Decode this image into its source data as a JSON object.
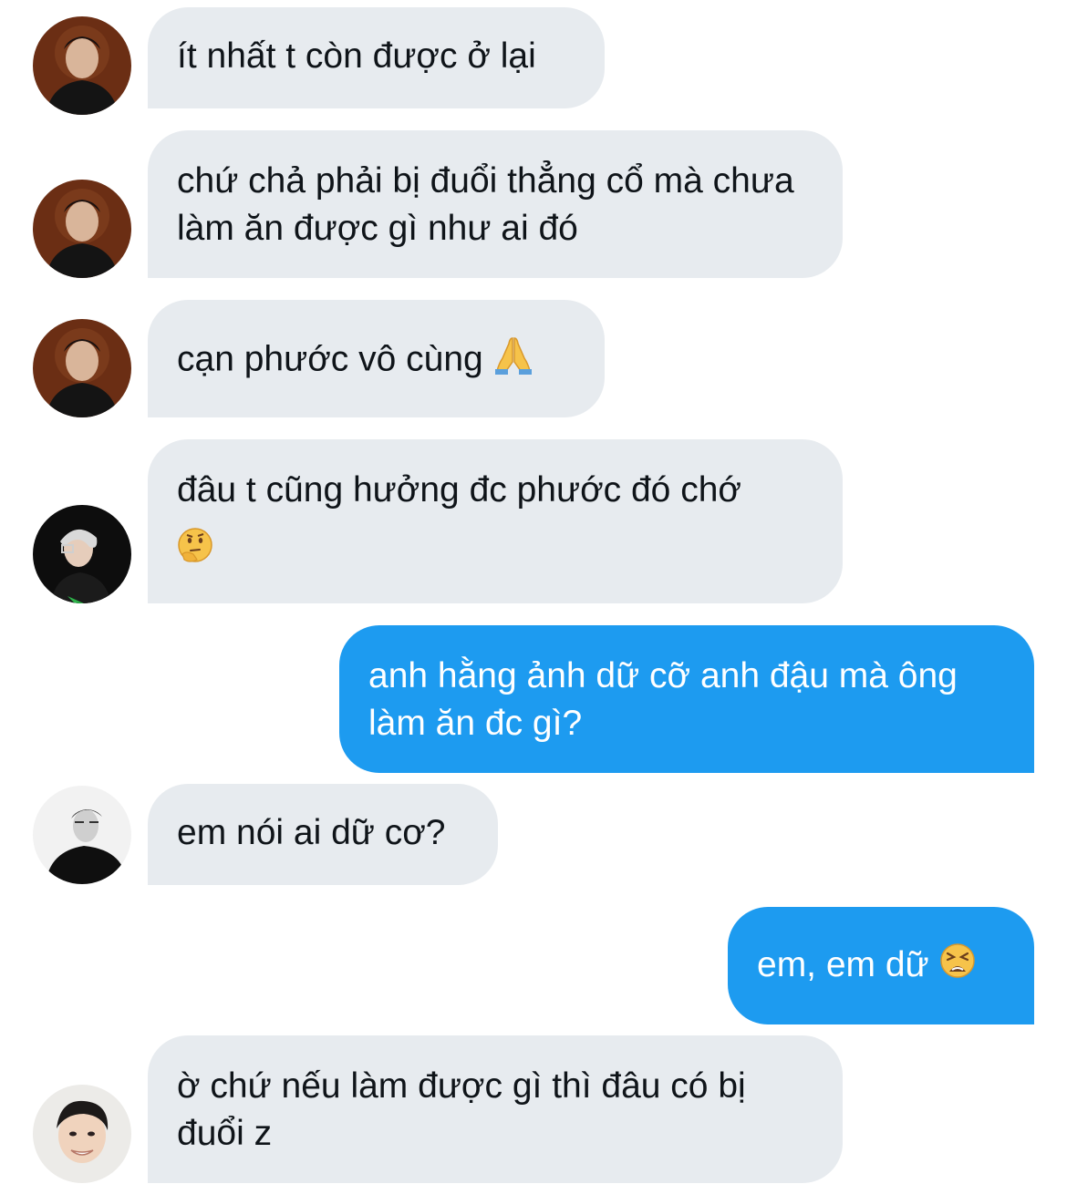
{
  "conversation": {
    "messages": [
      {
        "side": "incoming",
        "avatar": "avatar-1",
        "text": "ít nhất t còn được ở lại"
      },
      {
        "side": "incoming",
        "avatar": "avatar-1",
        "text": "chứ chả phải bị đuổi thẳng cổ mà chưa làm ăn được gì như ai đó"
      },
      {
        "side": "incoming",
        "avatar": "avatar-1",
        "text": "cạn phước vô cùng",
        "emoji": "folded-hands-icon"
      },
      {
        "side": "incoming",
        "avatar": "avatar-2",
        "text": "đâu t cũng hưởng đc phước đó chớ",
        "emoji": "thinking-face-icon"
      },
      {
        "side": "outgoing",
        "text": "anh hằng ảnh dữ cỡ anh đậu mà ông làm ăn đc gì?"
      },
      {
        "side": "incoming",
        "avatar": "avatar-3",
        "text": "em nói ai dữ cơ?"
      },
      {
        "side": "outgoing",
        "text": "em, em dữ",
        "emoji": "tired-face-icon"
      },
      {
        "side": "incoming",
        "avatar": "avatar-4",
        "text": "ờ chứ nếu làm được gì thì đâu có bị đuổi z"
      }
    ]
  },
  "colors": {
    "incoming_bubble": "#e7ebef",
    "outgoing_bubble": "#1d9bf0",
    "incoming_text": "#0f1419",
    "outgoing_text": "#ffffff"
  }
}
